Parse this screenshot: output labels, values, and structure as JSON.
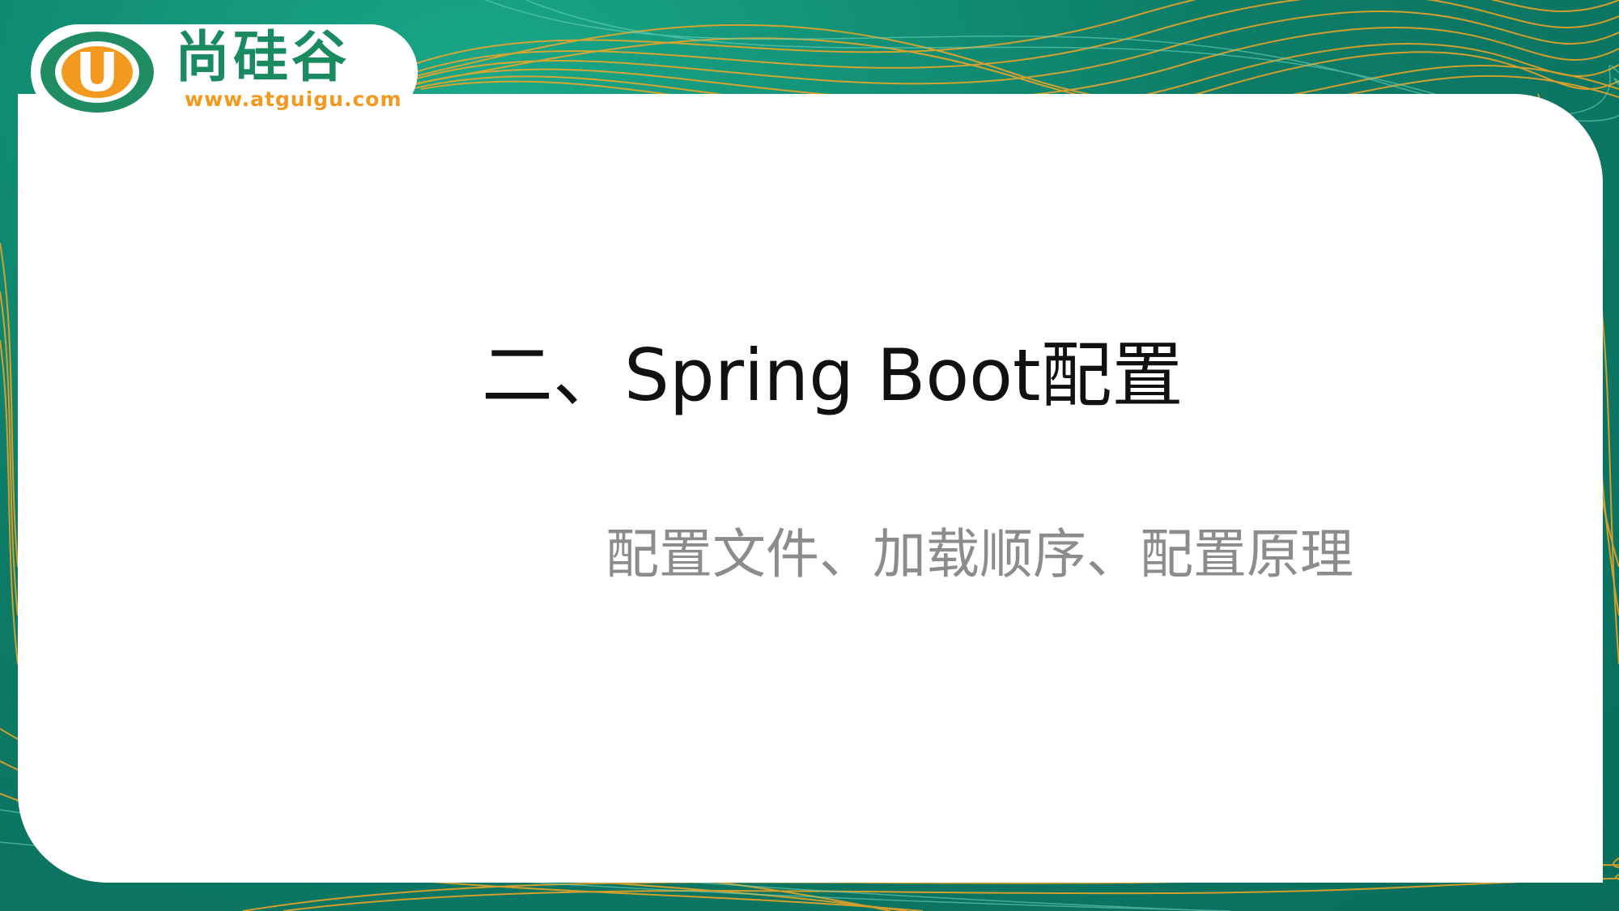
{
  "brand": {
    "logo_letter": "U",
    "name": "尚硅谷",
    "url": "www.atguigu.com"
  },
  "slide": {
    "title": "二、Spring Boot配置",
    "subtitle": "配置文件、加载顺序、配置原理"
  },
  "colors": {
    "background": "#0f8a72",
    "accent_lines": "#f5a623",
    "brand_green": "#1a8a61",
    "brand_orange": "#f19a1f",
    "subtitle_gray": "#8c8c8c"
  }
}
